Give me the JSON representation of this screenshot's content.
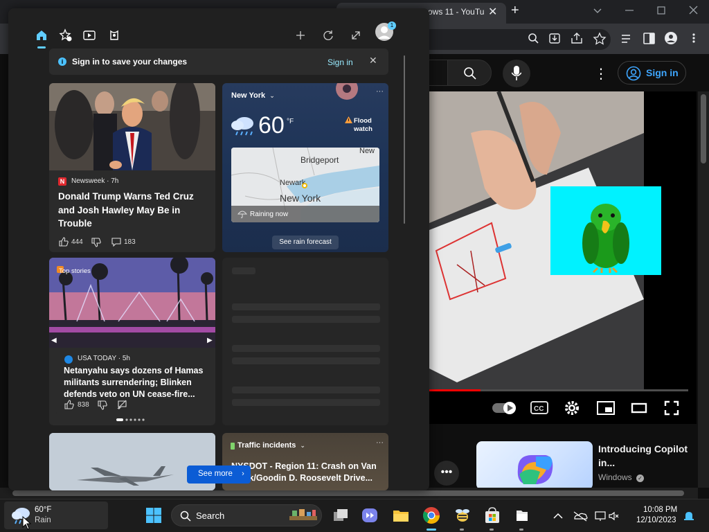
{
  "browser": {
    "tab_title": "ows 11 - YouTu",
    "yt_signin": "Sign in",
    "rec_title": "Introducing Copilot in...",
    "rec_channel": "Windows",
    "progress": 0.2
  },
  "widgets": {
    "signin_banner": {
      "text": "Sign in to save your changes",
      "link": "Sign in",
      "info_glyph": "i"
    },
    "news1": {
      "logo_letter": "N",
      "source": "Newsweek · 7h",
      "title": "Donald Trump Warns Ted Cruz and Josh Hawley May Be in Trouble",
      "likes": "444",
      "comments": "183"
    },
    "weather": {
      "city": "New York",
      "temp": "60",
      "unit": "°F",
      "alert": "Flood watch",
      "map_labels": [
        "Bridgeport",
        "Newark",
        "New York",
        "New"
      ],
      "status": "Raining now",
      "forecast_button": "See rain forecast"
    },
    "news2": {
      "topstories": "Top stories",
      "source": "USA TODAY · 5h",
      "title": "Netanyahu says dozens of Hamas militants surrendering; Blinken defends veto on UN cease-fire...",
      "likes": "838"
    },
    "traffic": {
      "heading": "Traffic incidents",
      "title": "NYSDOT - Region 11: Crash on Van Wyck/Goodin D. Roosevelt Drive..."
    },
    "see_more": "See more",
    "notification_badge": "1"
  },
  "taskbar": {
    "weather_temp": "60°F",
    "weather_cond": "Rain",
    "search_label": "Search",
    "time": "10:08 PM",
    "date": "12/10/2023"
  },
  "colors": {
    "accent": "#60cdff",
    "see_more_bg": "#0b5cd5",
    "yt_red": "#ff0000",
    "parrot_bg": "#00f2ff"
  }
}
